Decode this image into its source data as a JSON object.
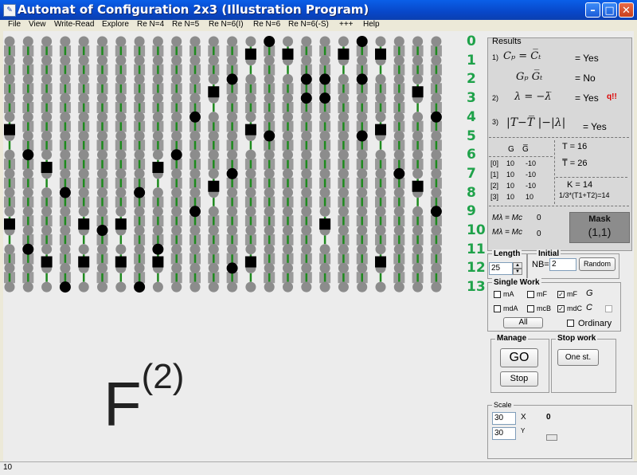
{
  "window": {
    "title": "Automat of Configuration 2x3 (Illustration Program)"
  },
  "menu": [
    "File",
    "View",
    "Write-Read",
    "Explore",
    "Re N=4",
    "Re N=5",
    "Re N=6(I)",
    "Re N=6",
    "Re N=6(-S)",
    "+++",
    "Help"
  ],
  "grid": {
    "rows": 14,
    "cols": 24,
    "row_labels": [
      "0",
      "1",
      "2",
      "3",
      "4",
      "5",
      "6",
      "7",
      "8",
      "9",
      "10",
      "11",
      "12",
      "13"
    ],
    "colors": {
      "pin_gray": "#8c8c8c",
      "line_green": "#1e8a1e",
      "square_black": "#000000",
      "dot_black": "#000000",
      "label_green": "#1fa24a"
    },
    "black_squares": [
      [
        1,
        13
      ],
      [
        1,
        15
      ],
      [
        1,
        18
      ],
      [
        1,
        20
      ],
      [
        3,
        11
      ],
      [
        3,
        22
      ],
      [
        5,
        0
      ],
      [
        5,
        13
      ],
      [
        5,
        20
      ],
      [
        7,
        2
      ],
      [
        7,
        8
      ],
      [
        8,
        11
      ],
      [
        8,
        22
      ],
      [
        10,
        0
      ],
      [
        10,
        4
      ],
      [
        10,
        6
      ],
      [
        10,
        17
      ],
      [
        12,
        2
      ],
      [
        12,
        4
      ],
      [
        12,
        6
      ],
      [
        12,
        8
      ],
      [
        12,
        13
      ],
      [
        12,
        20
      ]
    ],
    "black_dots": [
      [
        0,
        14
      ],
      [
        0,
        19
      ],
      [
        2,
        12
      ],
      [
        2,
        16
      ],
      [
        2,
        17
      ],
      [
        2,
        19
      ],
      [
        3,
        16
      ],
      [
        3,
        17
      ],
      [
        4,
        10
      ],
      [
        4,
        23
      ],
      [
        5,
        14
      ],
      [
        5,
        19
      ],
      [
        6,
        1
      ],
      [
        6,
        9
      ],
      [
        7,
        12
      ],
      [
        7,
        21
      ],
      [
        8,
        3
      ],
      [
        8,
        7
      ],
      [
        9,
        10
      ],
      [
        9,
        23
      ],
      [
        10,
        5
      ],
      [
        11,
        1
      ],
      [
        11,
        8
      ],
      [
        12,
        12
      ],
      [
        13,
        3
      ],
      [
        13,
        7
      ]
    ]
  },
  "formula": {
    "base": "F",
    "sup": "(2)"
  },
  "results": {
    "header": "Results",
    "item1_num": "1)",
    "item1_eq": "Cₚ = C̅ₜ",
    "item1_res": "= Yes",
    "item1b_eq": "Gₚ   G̅ₜ",
    "item1b_res": "= No",
    "item2_num": "2)",
    "item2_eq": "λ = −λ̅",
    "item2_res": "= Yes",
    "item2_flag": "q!!",
    "item3_num": "3)",
    "item3_eq": "|T−T̅ |−|λ|",
    "item3_res": "= Yes",
    "table_header": [
      "G",
      "G̅"
    ],
    "table_rows": [
      {
        "idx": "[0]",
        "g": "10",
        "gbar": "-10"
      },
      {
        "idx": "[1]",
        "g": "10",
        "gbar": "-10"
      },
      {
        "idx": "[2]",
        "g": "10",
        "gbar": "-10"
      },
      {
        "idx": "[3]",
        "g": "10",
        "gbar": "10"
      }
    ],
    "T": "T = 16",
    "Tbar": "T̅ = 26",
    "K": "K = 14",
    "formula_k": "1/3*(T1+T2)=14",
    "mk1": "Mλ = Mc",
    "mk1_val": "0",
    "mk2": "Mλ = Mc",
    "mk2_val": "0",
    "mask_title": "Mask",
    "mask_value": "(1,1)"
  },
  "length": {
    "label": "Length",
    "value": "25"
  },
  "initial": {
    "label": "Initial",
    "nb_label": "NB=",
    "nb_value": "2",
    "random_label": "Random"
  },
  "single_work": {
    "label": "Single Work",
    "checks": [
      {
        "label": "mA",
        "checked": false
      },
      {
        "label": "mF",
        "checked": false
      },
      {
        "label": "mF",
        "checked": true,
        "extra": "G"
      },
      {
        "label": "mdA",
        "checked": false
      },
      {
        "label": "mcB",
        "checked": false
      },
      {
        "label": "mdC",
        "checked": true,
        "extra": "C"
      }
    ],
    "all_label": "All",
    "ordinary_label": "Ordinary"
  },
  "manage": {
    "label": "Manage",
    "go_label": "GO",
    "stop_label": "Stop"
  },
  "stop_work": {
    "label": "Stop work",
    "one_step_label": "One st."
  },
  "scale": {
    "label": "Scale",
    "x_value": "30",
    "y_value": "30",
    "x_sym": "X",
    "y_sym": "Y",
    "readout": "0"
  },
  "status": {
    "text": "10"
  }
}
